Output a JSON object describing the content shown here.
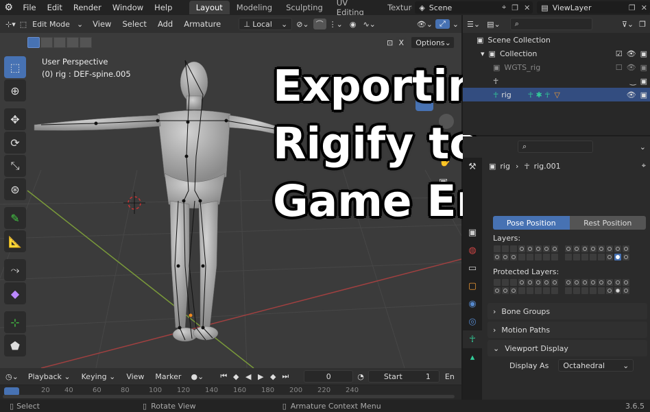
{
  "topbar": {
    "menus": [
      "File",
      "Edit",
      "Render",
      "Window",
      "Help"
    ],
    "workspaces": [
      "Layout",
      "Modeling",
      "Sculpting",
      "UV Editing",
      "Texture"
    ],
    "scene": "Scene",
    "view_layer": "ViewLayer"
  },
  "header": {
    "mode": "Edit Mode",
    "menus": [
      "View",
      "Select",
      "Add",
      "Armature"
    ],
    "orientation": "Local",
    "options": "Options",
    "x_label": "X"
  },
  "viewport": {
    "perspective": "User Perspective",
    "object_info": "(0) rig : DEF-spine.005"
  },
  "overlay_title": {
    "line1": "Exporting",
    "line2": "Rigify to",
    "line3": "Game Engine"
  },
  "outliner": {
    "scene_collection": "Scene Collection",
    "collection": "Collection",
    "item1": "WGTS_rig",
    "item2": "rig"
  },
  "properties": {
    "breadcrumb_obj": "rig",
    "breadcrumb_data": "rig.001",
    "pose_position": "Pose Position",
    "rest_position": "Rest Position",
    "layers": "Layers:",
    "protected_layers": "Protected Layers:",
    "bone_groups": "Bone Groups",
    "motion_paths": "Motion Paths",
    "viewport_display": "Viewport Display",
    "display_as_label": "Display As",
    "display_as_value": "Octahedral"
  },
  "timeline": {
    "playback": "Playback",
    "keying": "Keying",
    "view": "View",
    "marker": "Marker",
    "current_frame": "0",
    "start_label": "Start",
    "start_value": "1",
    "end_label": "En",
    "ruler": [
      "20",
      "40",
      "60",
      "80",
      "100",
      "120",
      "140",
      "160",
      "180",
      "200",
      "220",
      "240"
    ]
  },
  "statusbar": {
    "select": "Select",
    "rotate": "Rotate View",
    "context": "Armature Context Menu",
    "version": "3.6.5"
  },
  "colors": {
    "accent": "#4772b3",
    "bg": "#303030"
  }
}
